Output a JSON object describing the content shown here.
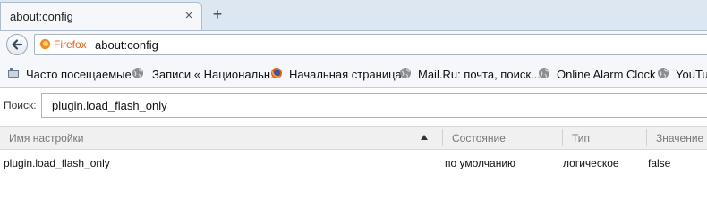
{
  "tab": {
    "title": "about:config",
    "close_glyph": "×",
    "new_tab_glyph": "+"
  },
  "navbar": {
    "identity_label": "Firefox",
    "url": "about:config"
  },
  "bookmarks": [
    {
      "label": "Часто посещаемые",
      "icon": "bookmarks-folder-icon"
    },
    {
      "label": "Записи « Национальн...",
      "icon": "globe-icon"
    },
    {
      "label": "Начальная страница",
      "icon": "firefox-icon"
    },
    {
      "label": "Mail.Ru: почта, поиск...",
      "icon": "globe-icon"
    },
    {
      "label": "Online Alarm Clock",
      "icon": "globe-icon"
    },
    {
      "label": "YouTu",
      "icon": "globe-icon"
    }
  ],
  "search": {
    "label": "Поиск:",
    "value": "plugin.load_flash_only"
  },
  "table": {
    "columns": [
      "Имя настройки",
      "Состояние",
      "Тип",
      "Значение"
    ],
    "rows": [
      {
        "name": "plugin.load_flash_only",
        "status": "по умолчанию",
        "type": "логическое",
        "value": "false"
      }
    ]
  },
  "colors": {
    "firefox_label": "#e0641e",
    "titlebar": "#dce7f2",
    "header": "#f0f0f0"
  }
}
